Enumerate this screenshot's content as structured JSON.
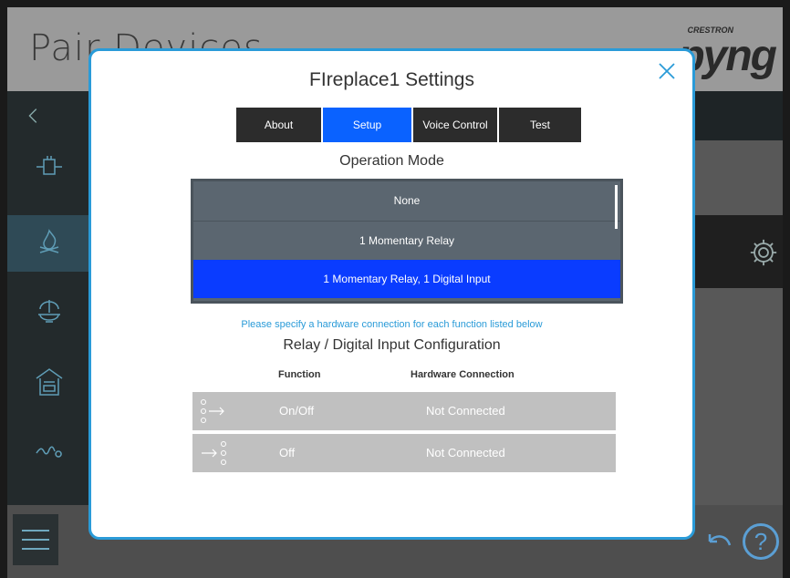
{
  "app": {
    "title": "Pair Devices",
    "brand_small": "CRESTRON",
    "brand_big": "pyng"
  },
  "modal": {
    "title": "FIreplace1 Settings",
    "tabs": [
      {
        "label": "About",
        "active": false
      },
      {
        "label": "Setup",
        "active": true
      },
      {
        "label": "Voice Control",
        "active": false
      },
      {
        "label": "Test",
        "active": false
      }
    ],
    "operation_mode_label": "Operation Mode",
    "modes": [
      {
        "label": "None",
        "selected": false
      },
      {
        "label": "1 Momentary Relay",
        "selected": false
      },
      {
        "label": "1 Momentary Relay, 1 Digital Input",
        "selected": true
      }
    ],
    "hint": "Please specify a hardware connection for each function listed below",
    "config_title": "Relay / Digital Input Configuration",
    "columns": {
      "function": "Function",
      "hardware": "Hardware Connection"
    },
    "rows": [
      {
        "function": "On/Off",
        "hardware": "Not Connected",
        "icon": "relay-output-icon"
      },
      {
        "function": "Off",
        "hardware": "Not Connected",
        "icon": "digital-input-icon"
      }
    ]
  },
  "bottom": {
    "help_label": "?"
  },
  "colors": {
    "accent": "#2a9bd8",
    "selected": "#0a3cff",
    "tab_active": "#0a62ff",
    "tab_inactive": "#2c2c2c"
  }
}
